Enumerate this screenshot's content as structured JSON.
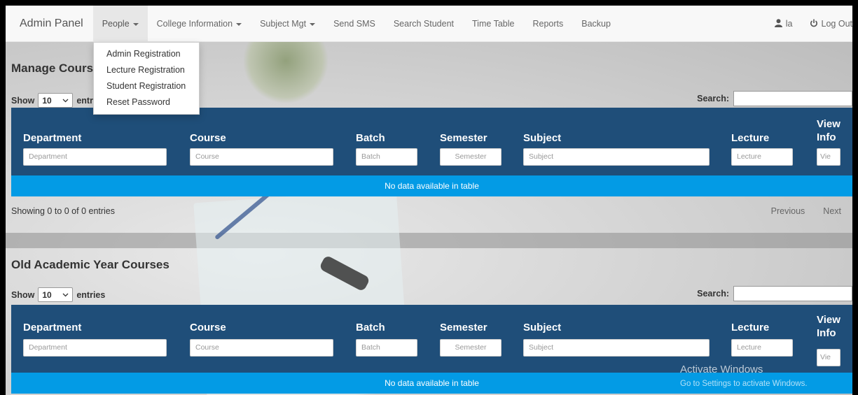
{
  "navbar": {
    "brand": "Admin Panel",
    "items": [
      {
        "label": "People",
        "has_caret": true,
        "active": true
      },
      {
        "label": "College Information",
        "has_caret": true
      },
      {
        "label": "Subject Mgt",
        "has_caret": true
      },
      {
        "label": "Send SMS"
      },
      {
        "label": "Search Student"
      },
      {
        "label": "Time Table"
      },
      {
        "label": "Reports"
      },
      {
        "label": "Backup"
      }
    ],
    "user": {
      "icon": "user-icon",
      "label": "la"
    },
    "logout": {
      "icon": "power-icon",
      "label": "Log Out"
    }
  },
  "people_dropdown": [
    "Admin Registration",
    "Lecture Registration",
    "Student Registration",
    "Reset Password"
  ],
  "manage_courses": {
    "title": "Manage Courses",
    "show_label": "Show",
    "page_size": "10",
    "entries_label": "entries",
    "search_label": "Search:",
    "columns": [
      {
        "label": "Department",
        "filter_placeholder": "Department"
      },
      {
        "label": "Course",
        "filter_placeholder": "Course"
      },
      {
        "label": "Batch",
        "filter_placeholder": "Batch"
      },
      {
        "label": "Semester",
        "filter_placeholder": "Semester"
      },
      {
        "label": "Subject",
        "filter_placeholder": "Subject"
      },
      {
        "label": "Lecture",
        "filter_placeholder": "Lecture"
      },
      {
        "label": "View Info",
        "filter_placeholder": "Vie"
      }
    ],
    "empty_message": "No data available in table",
    "info": "Showing 0 to 0 of 0 entries",
    "prev_label": "Previous",
    "next_label": "Next"
  },
  "old_courses": {
    "title": "Old Academic Year Courses",
    "show_label": "Show",
    "page_size": "10",
    "entries_label": "entries",
    "search_label": "Search:",
    "columns": [
      {
        "label": "Department",
        "filter_placeholder": "Department"
      },
      {
        "label": "Course",
        "filter_placeholder": "Course"
      },
      {
        "label": "Batch",
        "filter_placeholder": "Batch"
      },
      {
        "label": "Semester",
        "filter_placeholder": "Semester"
      },
      {
        "label": "Subject",
        "filter_placeholder": "Subject"
      },
      {
        "label": "Lecture",
        "filter_placeholder": "Lecture"
      },
      {
        "label": "View Info",
        "filter_placeholder": "Vie"
      }
    ],
    "empty_message": "No data available in table"
  },
  "watermark": {
    "title": "Activate Windows",
    "subtitle": "Go to Settings to activate Windows."
  },
  "colors": {
    "table_header": "#1f4e79",
    "empty_row": "#039be5",
    "navbar": "#f8f8f8"
  }
}
